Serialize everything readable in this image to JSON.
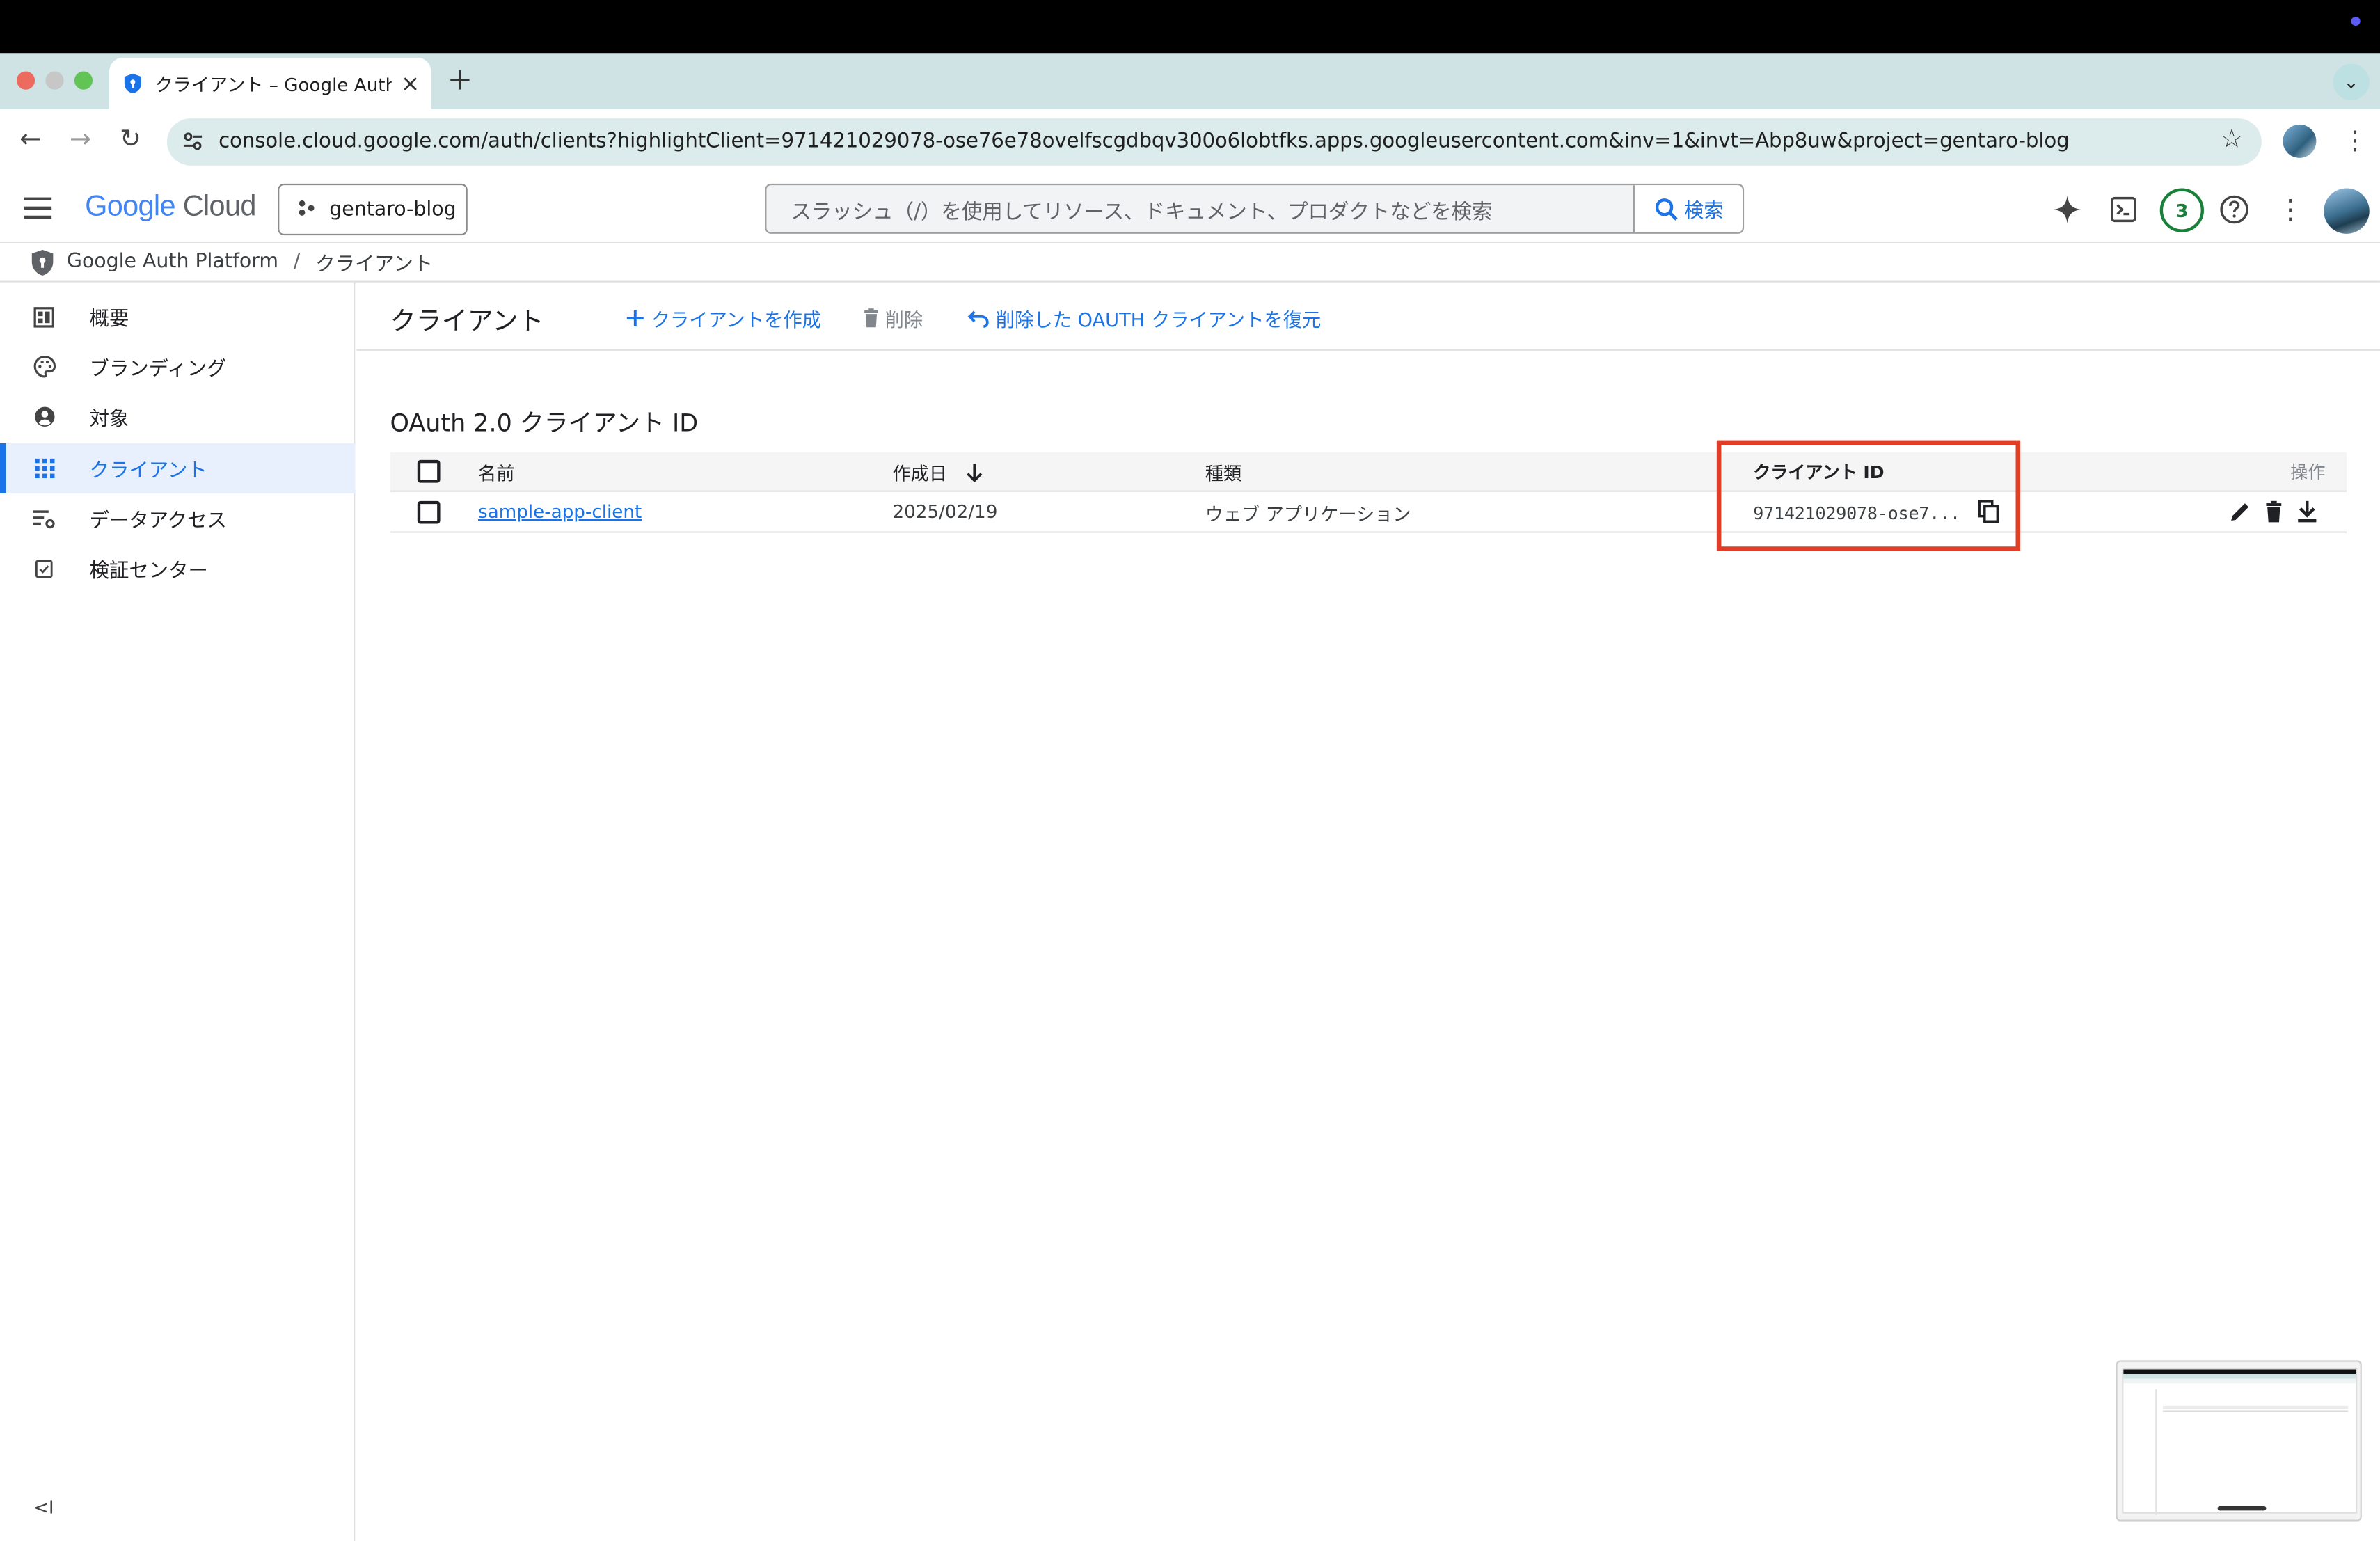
{
  "browser": {
    "tab_title": "クライアント – Google Auth Platform",
    "tab_close": "×",
    "new_tab": "+",
    "url": "console.cloud.google.com/auth/clients?highlightClient=971421029078-ose76e78ovelfscgdbqv300o6lobtfks.apps.googleusercontent.com&inv=1&invt=Abp8uw&project=gentaro-blog"
  },
  "header": {
    "logo_google": "Google",
    "logo_cloud": "Cloud",
    "project": "gentaro-blog",
    "search_placeholder": "スラッシュ（/）を使用してリソース、ドキュメント、プロダクトなどを検索",
    "search_button": "検索",
    "notifications_count": "3"
  },
  "breadcrumb": {
    "product": "Google Auth Platform",
    "separator": "/",
    "current": "クライアント"
  },
  "sidebar": {
    "items": [
      {
        "label": "概要",
        "icon": "dashboard-icon"
      },
      {
        "label": "ブランディング",
        "icon": "palette-icon"
      },
      {
        "label": "対象",
        "icon": "account-circle-icon"
      },
      {
        "label": "クライアント",
        "icon": "apps-grid-icon",
        "active": true
      },
      {
        "label": "データアクセス",
        "icon": "data-settings-icon"
      },
      {
        "label": "検証センター",
        "icon": "verified-checkbox-icon"
      }
    ],
    "collapse_label": "<I"
  },
  "page": {
    "title": "クライアント",
    "actions": {
      "create": "クライアントを作成",
      "delete": "削除",
      "restore": "削除した OAUTH クライアントを復元"
    },
    "section_title": "OAuth 2.0 クライアント ID"
  },
  "table": {
    "columns": {
      "name": "名前",
      "created": "作成日",
      "type": "種類",
      "client_id": "クライアント ID",
      "actions": "操作"
    },
    "rows": [
      {
        "name": "sample-app-client",
        "created": "2025/02/19",
        "type": "ウェブ アプリケーション",
        "client_id": "971421029078-ose7..."
      }
    ]
  },
  "colors": {
    "accent": "#1a73e8",
    "highlight_box": "#e23d26",
    "active_bg": "#e8f0fe",
    "notification_green": "#188038"
  }
}
